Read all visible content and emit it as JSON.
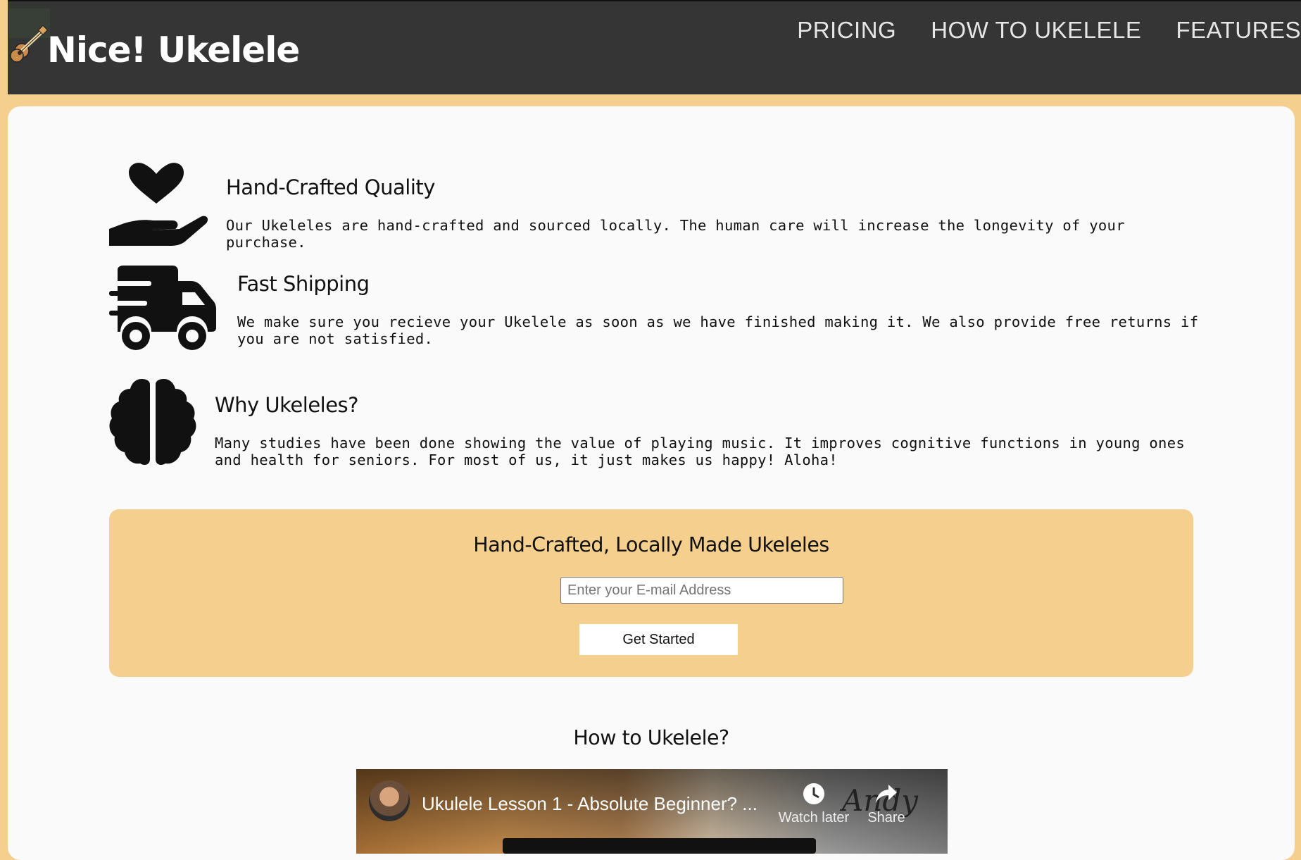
{
  "header": {
    "brand": "Nice! Ukelele",
    "nav": [
      "PRICING",
      "HOW TO UKELELE",
      "FEATURES"
    ]
  },
  "features": [
    {
      "icon": "hand-heart-icon",
      "title": "Hand-Crafted Quality",
      "text": "Our Ukeleles are hand-crafted and sourced locally. The human care will increase the longevity of your purchase."
    },
    {
      "icon": "shipping-truck-icon",
      "title": "Fast Shipping",
      "text": "We make sure you recieve your Ukelele as soon as we have finished making it. We also provide free returns if you are not satisfied."
    },
    {
      "icon": "brain-icon",
      "title": "Why Ukeleles?",
      "text": "Many studies have been done showing the value of playing music. It improves cognitive functions in young ones and health for seniors. For most of us, it just makes us happy! Aloha!"
    }
  ],
  "signup": {
    "heading": "Hand-Crafted, Locally Made Ukeleles",
    "email_placeholder": "Enter your E-mail Address",
    "button": "Get Started"
  },
  "video_section": {
    "heading": "How to Ukelele?",
    "video_title": "Ukulele Lesson 1 - Absolute Beginner? ...",
    "watch_later": "Watch later",
    "share": "Share",
    "watermark": "Andy"
  },
  "colors": {
    "header_bg": "#353535",
    "accent": "#f5cf8e",
    "card_bg": "#fafafa"
  }
}
